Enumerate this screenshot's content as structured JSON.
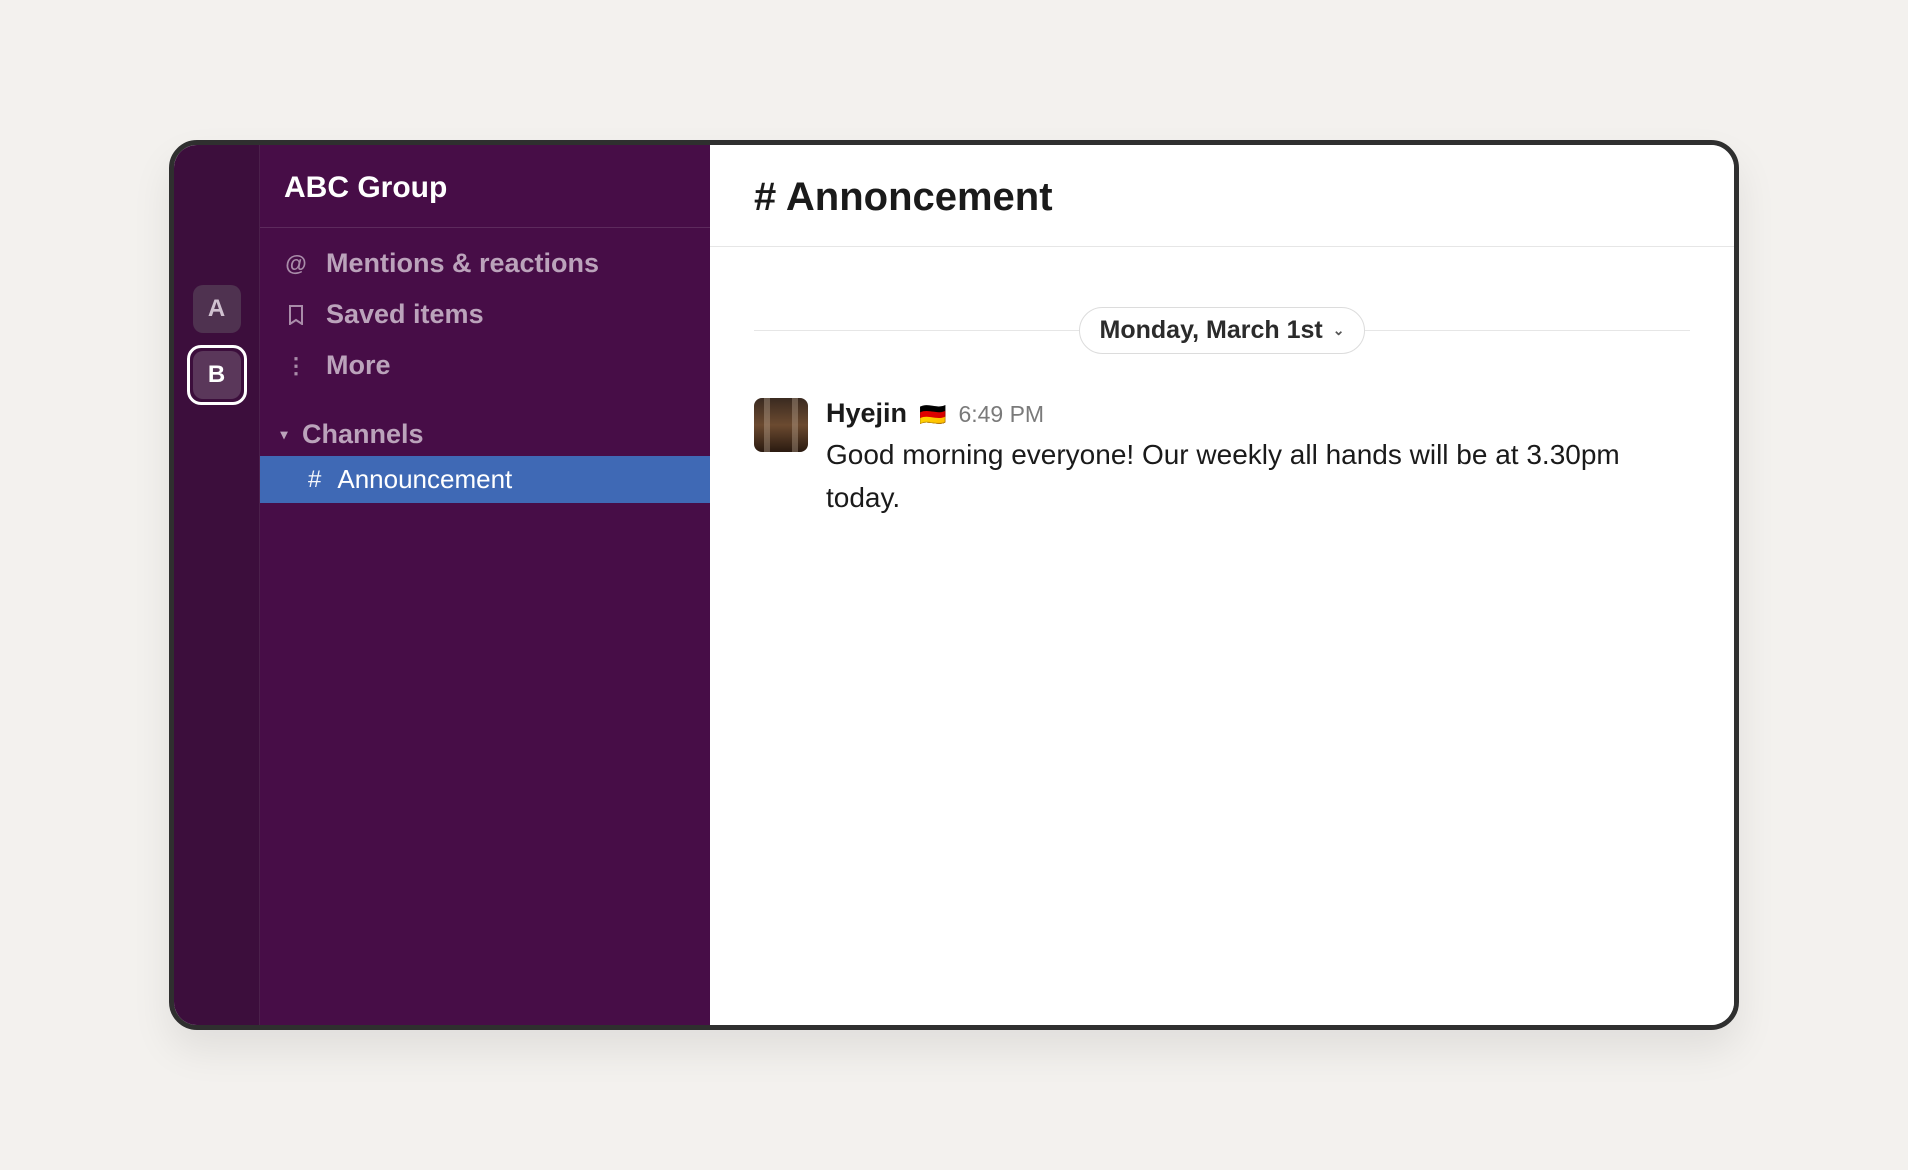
{
  "workspaces": [
    {
      "label": "A",
      "active": false
    },
    {
      "label": "B",
      "active": true
    }
  ],
  "sidebar": {
    "title": "ABC Group",
    "nav": {
      "mentions": "Mentions & reactions",
      "saved": "Saved items",
      "more": "More"
    },
    "channels_label": "Channels",
    "channels": [
      {
        "name": "Announcement"
      }
    ]
  },
  "main": {
    "channel_title": "# Annoncement",
    "date_divider": "Monday, March 1st",
    "message": {
      "sender": "Hyejin",
      "flag": "🇩🇪",
      "time": "6:49 PM",
      "text": "Good morning everyone! Our weekly all hands will be at 3.30pm today."
    }
  }
}
